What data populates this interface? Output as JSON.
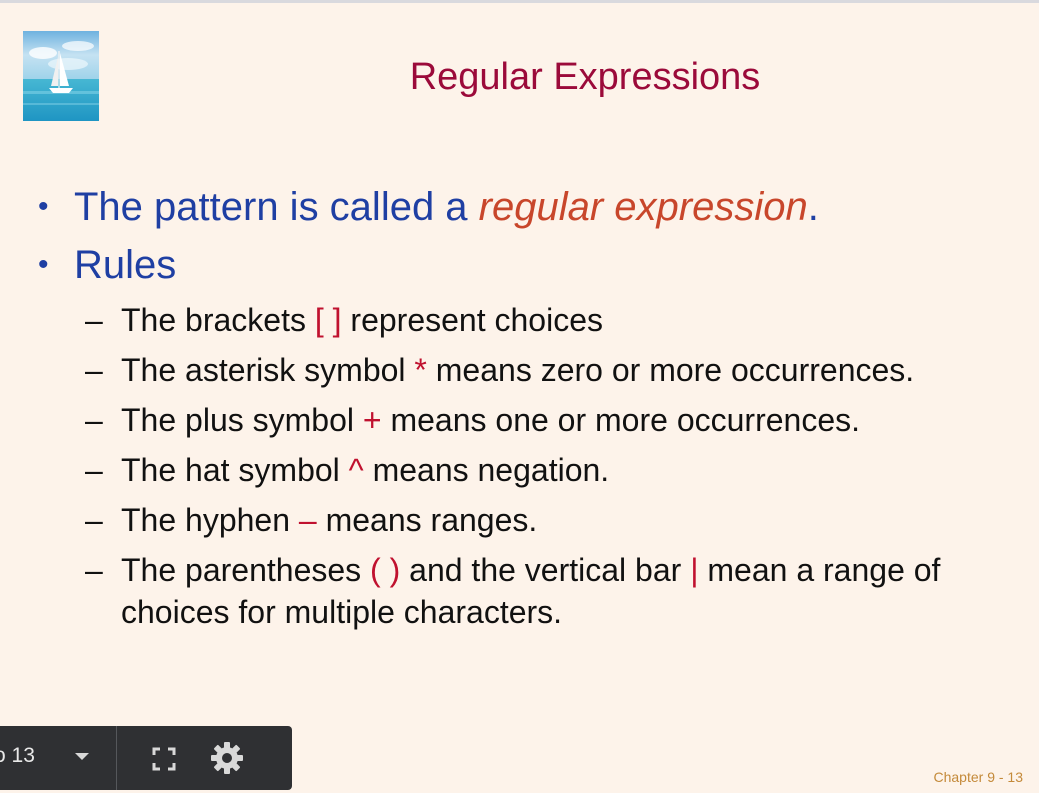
{
  "slide": {
    "title": "Regular Expressions",
    "bullet1": {
      "prefix": "The pattern is called a ",
      "emphasis": "regular expression",
      "suffix": "."
    },
    "bullet2": "Rules",
    "rules": [
      {
        "before": "The brackets ",
        "symbol": "[ ]",
        "after": " represent choices"
      },
      {
        "before": "The asterisk symbol ",
        "symbol": "*",
        "after": " means zero or more occurrences."
      },
      {
        "before": "The plus symbol ",
        "symbol": "+",
        "after": " means one or more occurrences."
      },
      {
        "before": "The hat symbol ",
        "symbol": "^",
        "after": " means negation."
      },
      {
        "before": "The hyphen ",
        "symbol": "–",
        "after": " means ranges."
      },
      {
        "before": "The parentheses ",
        "symbol": "( )",
        "middle": " and the vertical bar ",
        "symbol2": "|",
        "after": " mean a range of choices for multiple characters."
      }
    ],
    "footer": "Chapter 9 - 13",
    "bullet_char": "•",
    "dash_char": "–"
  },
  "toolbar": {
    "page_label": "o 13",
    "icons": [
      "chevron-down-icon",
      "fullscreen-icon",
      "gear-icon"
    ]
  },
  "colors": {
    "background": "#fdf3ea",
    "title": "#9b0a3a",
    "bullet": "#1f3fa3",
    "emphasis": "#c8462b",
    "symbol": "#c0112f",
    "footer": "#c48a3a"
  }
}
